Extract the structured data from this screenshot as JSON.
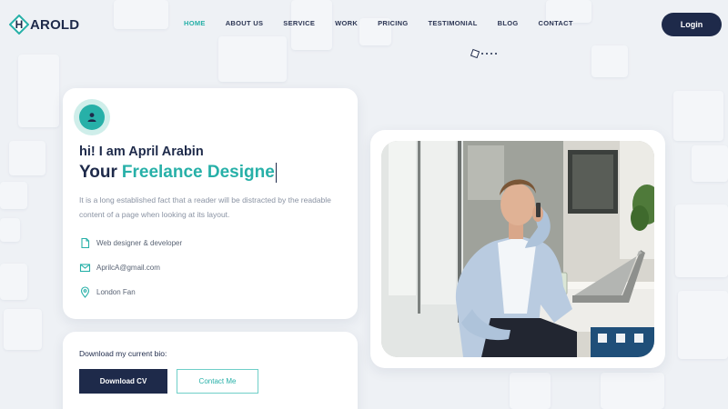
{
  "brand": {
    "logo_letter": "H",
    "logo_rest": "AROLD"
  },
  "nav": {
    "items": [
      {
        "label": "HOME",
        "active": true
      },
      {
        "label": "ABOUT US"
      },
      {
        "label": "SERVICE"
      },
      {
        "label": "WORK"
      },
      {
        "label": "PRICING"
      },
      {
        "label": "TESTIMONIAL"
      },
      {
        "label": "BLOG"
      },
      {
        "label": "CONTACT"
      }
    ],
    "login_label": "Login"
  },
  "profile": {
    "greeting": "hi! I am April Arabin",
    "headline_prefix": "Your",
    "headline_accent": "Freelance Designe",
    "description": "It is a long established fact that a reader will be distracted by the readable content of a page when looking at its layout.",
    "role": "Web designer & developer",
    "email": "AprilcA@gmail.com",
    "location": "London Fan",
    "icons": {
      "avatar": "user-icon",
      "role": "document-icon",
      "email": "mail-icon",
      "location": "map-pin-icon"
    }
  },
  "bio": {
    "label": "Download my current bio:",
    "download_label": "Download CV",
    "contact_label": "Contact Me"
  },
  "colors": {
    "accent": "#27b0a8",
    "navy": "#1e2a4a",
    "background": "#eef1f5"
  }
}
